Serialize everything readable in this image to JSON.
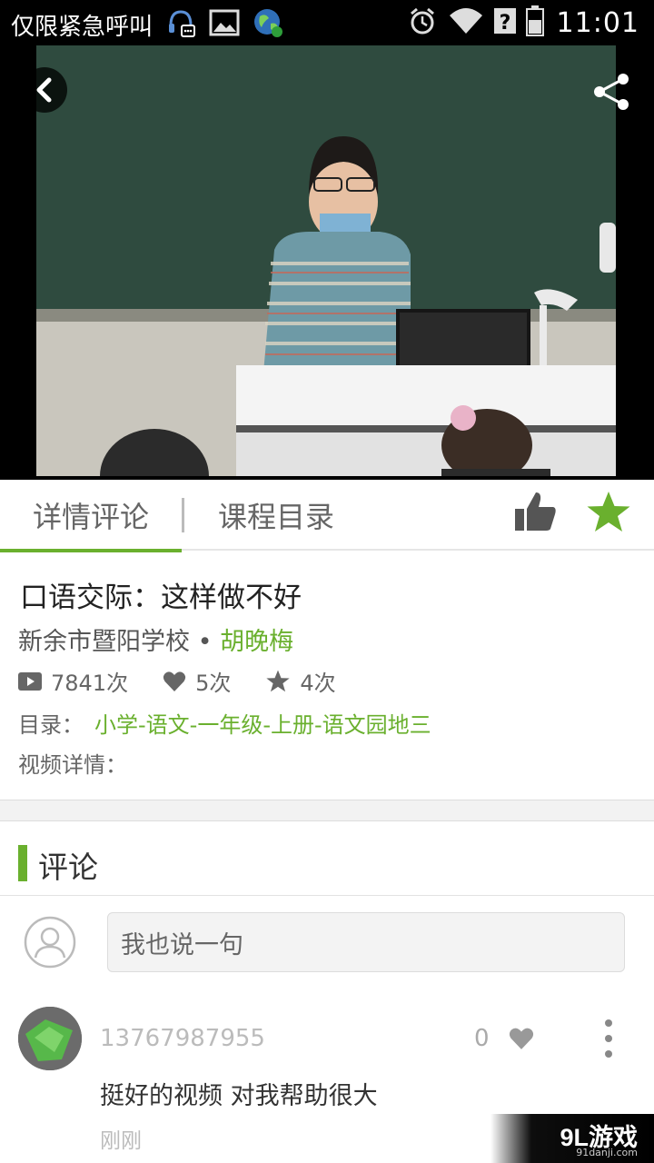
{
  "status_bar": {
    "carrier": "仅限紧急呼叫",
    "time": "11:01"
  },
  "tabs": [
    {
      "label": "详情评论",
      "active": true
    },
    {
      "label": "课程目录",
      "active": false
    }
  ],
  "video": {
    "title": "口语交际：这样做不好",
    "school": "新余市暨阳学校",
    "separator": "•",
    "teacher": "胡晚梅",
    "views": "7841次",
    "likes": "5次",
    "favorites": "4次",
    "catalog_label": "目录：",
    "catalog_path": "小学-语文-一年级-上册-语文园地三",
    "details_label": "视频详情："
  },
  "comments": {
    "title": "评论",
    "input_placeholder": "我也说一句",
    "items": [
      {
        "user": "13767987955",
        "likes": "0",
        "text": "挺好的视频 对我帮助很大",
        "time": "刚刚"
      }
    ]
  },
  "watermark": {
    "brand": "9L游戏",
    "domain": "91danji.com"
  },
  "colors": {
    "accent": "#6ab02e",
    "status_bar": "#000000",
    "text_dark": "#333333",
    "text_muted": "#666666"
  },
  "icons": [
    "back-arrow-icon",
    "share-icon",
    "thumbs-up-icon",
    "star-icon",
    "video-icon",
    "heart-icon",
    "user-avatar-icon",
    "more-vertical-icon"
  ]
}
